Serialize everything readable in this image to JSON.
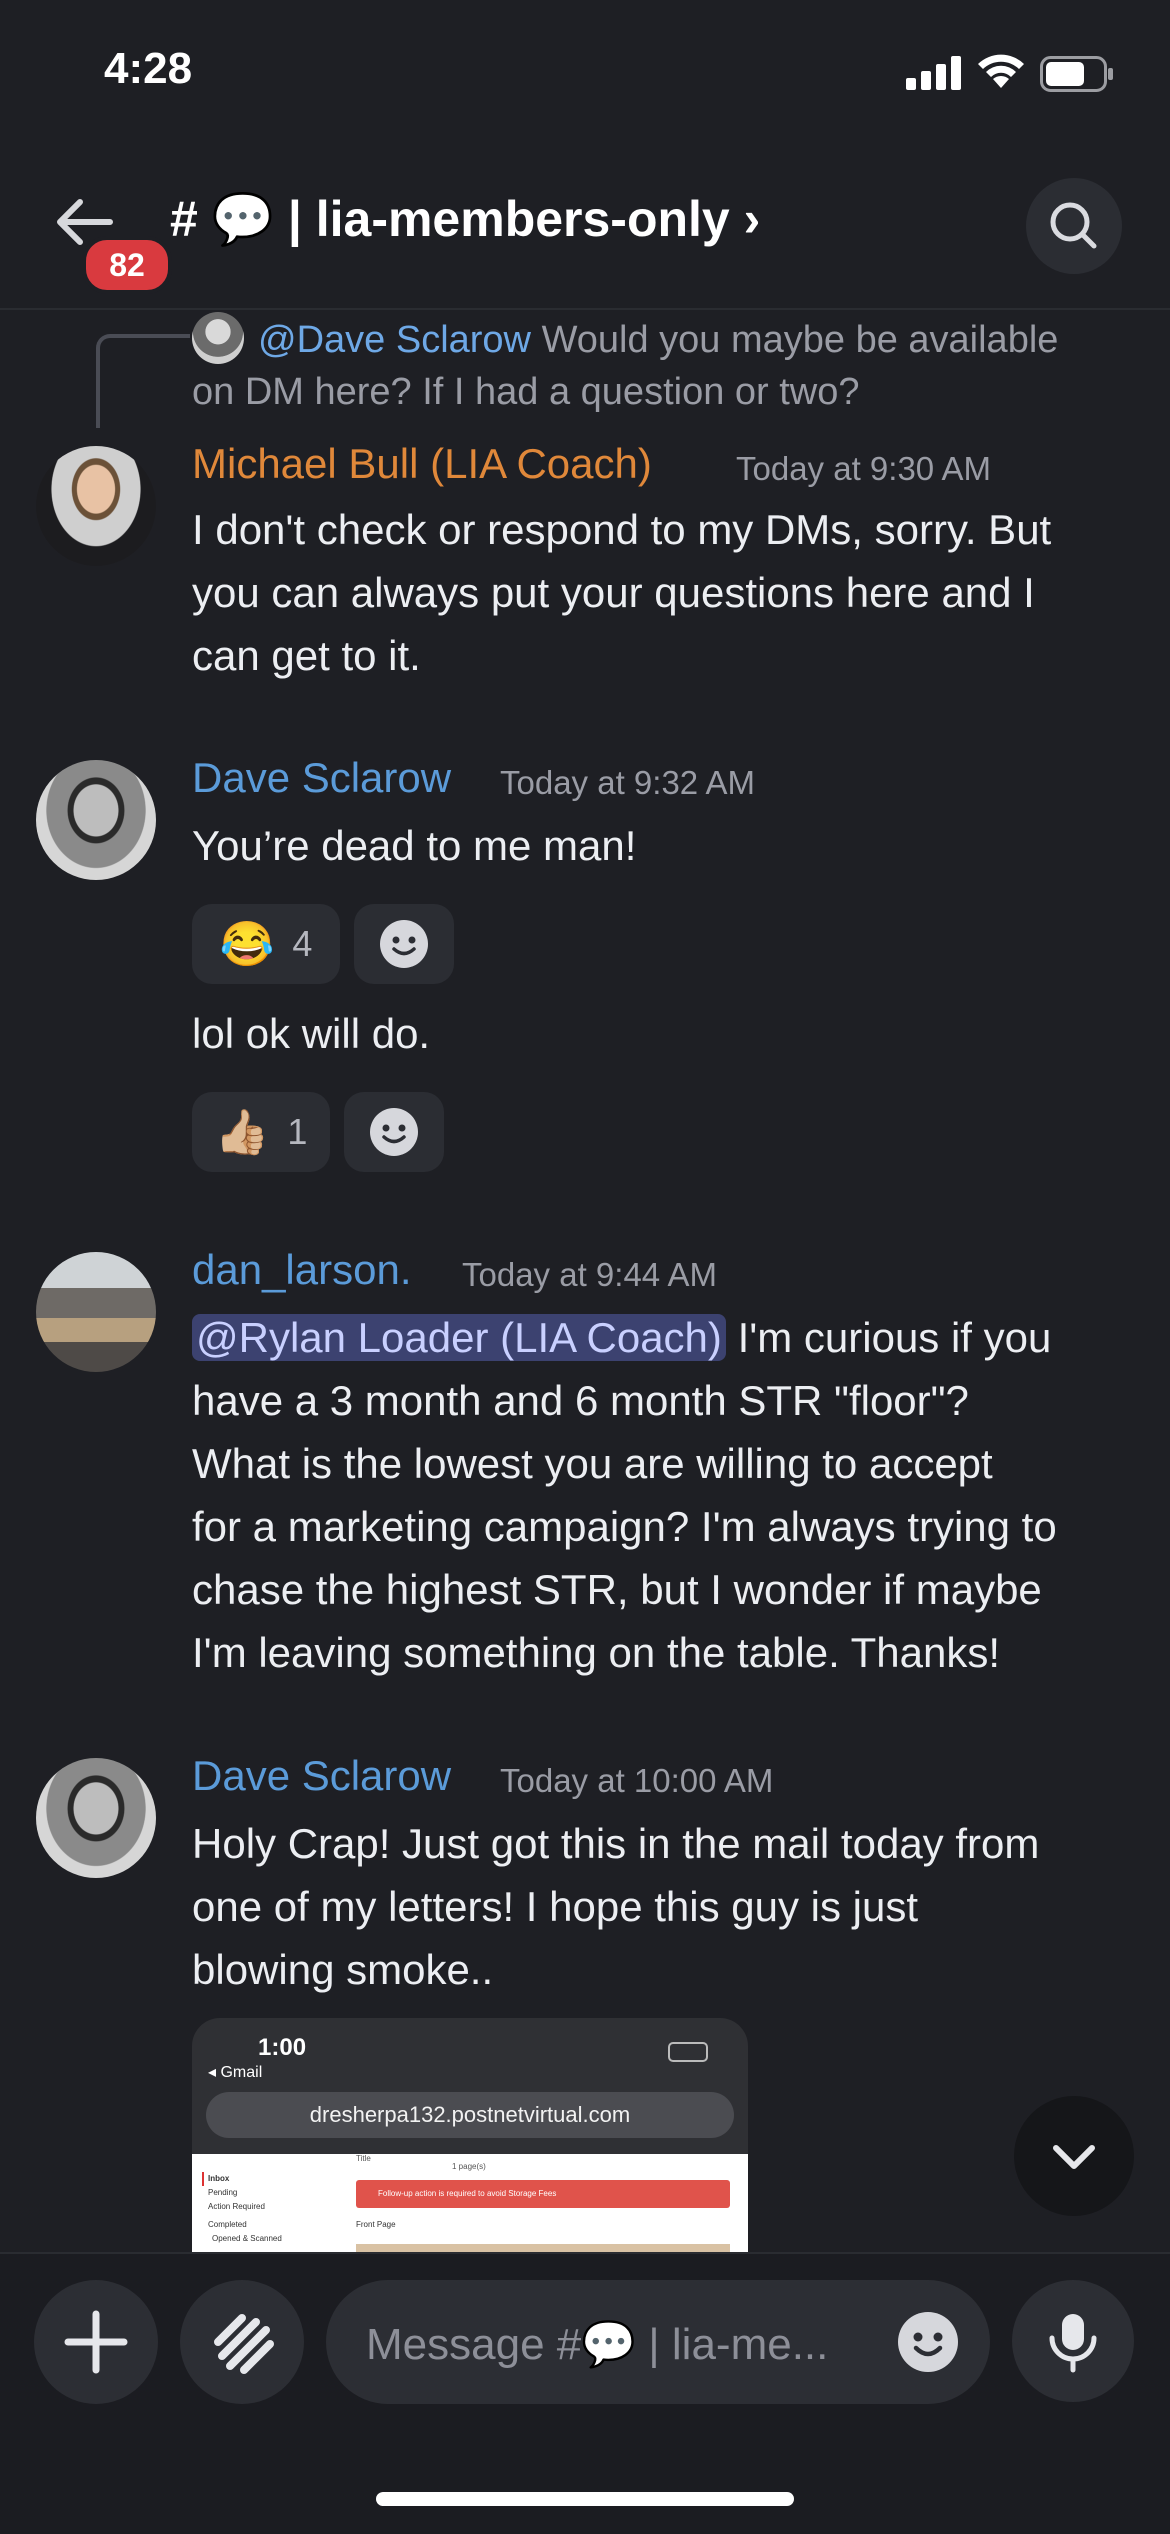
{
  "status_bar": {
    "time": "4:28"
  },
  "header": {
    "unread_badge": "82",
    "channel_title": "# 💬 | lia-members-only ›"
  },
  "reply_preview": {
    "mention": "@Dave Sclarow",
    "text_line1": "Would you maybe be available",
    "text_line2": "on DM here? If I had a question or two?"
  },
  "messages": [
    {
      "author": "Michael Bull (LIA Coach)",
      "author_color": "#e0883a",
      "time": "Today at 9:30 AM",
      "lines": [
        "I don't check or respond to my DMs, sorry. But",
        "you can always put your questions here and I",
        "can get to it."
      ]
    },
    {
      "author": "Dave Sclarow",
      "author_color": "#5b9bd9",
      "time": "Today at 9:32 AM",
      "lines": [
        "You’re dead to me man!"
      ],
      "reaction": {
        "emoji": "😂",
        "count": "4"
      },
      "followup": "lol ok will do.",
      "followup_reaction": {
        "emoji": "👍🏼",
        "count": "1"
      }
    },
    {
      "author": "dan_larson.",
      "author_color": "#5b9bd9",
      "time": "Today at 9:44 AM",
      "mention": "@Rylan Loader (LIA Coach)",
      "first_line_rest": " I'm curious if you",
      "lines": [
        "have a 3 month and 6 month STR \"floor\"?",
        "What is the lowest you are willing to accept",
        "for a marketing campaign? I'm always trying to",
        "chase the highest STR, but I wonder if maybe",
        "I'm leaving something on the table. Thanks!"
      ]
    },
    {
      "author": "Dave Sclarow",
      "author_color": "#5b9bd9",
      "time": "Today at 10:00 AM",
      "lines": [
        "Holy Crap! Just got this in the mail today from",
        "one of my letters! I hope this guy is just",
        "blowing smoke.."
      ]
    }
  ],
  "embed_screenshot": {
    "time": "1:00",
    "back_label": "◂ Gmail",
    "url": "dresherpa132.postnetvirtual.com",
    "sidebar_items": [
      "Inbox",
      "Pending",
      "Action Required",
      "Completed",
      "Opened & Scanned"
    ],
    "alert_text": "Follow-up action is required to avoid Storage Fees",
    "front_page_label": "Front Page",
    "title_label": "Title",
    "pages_label": "1 page(s)"
  },
  "composer": {
    "placeholder": "Message #💬 | lia-me..."
  }
}
